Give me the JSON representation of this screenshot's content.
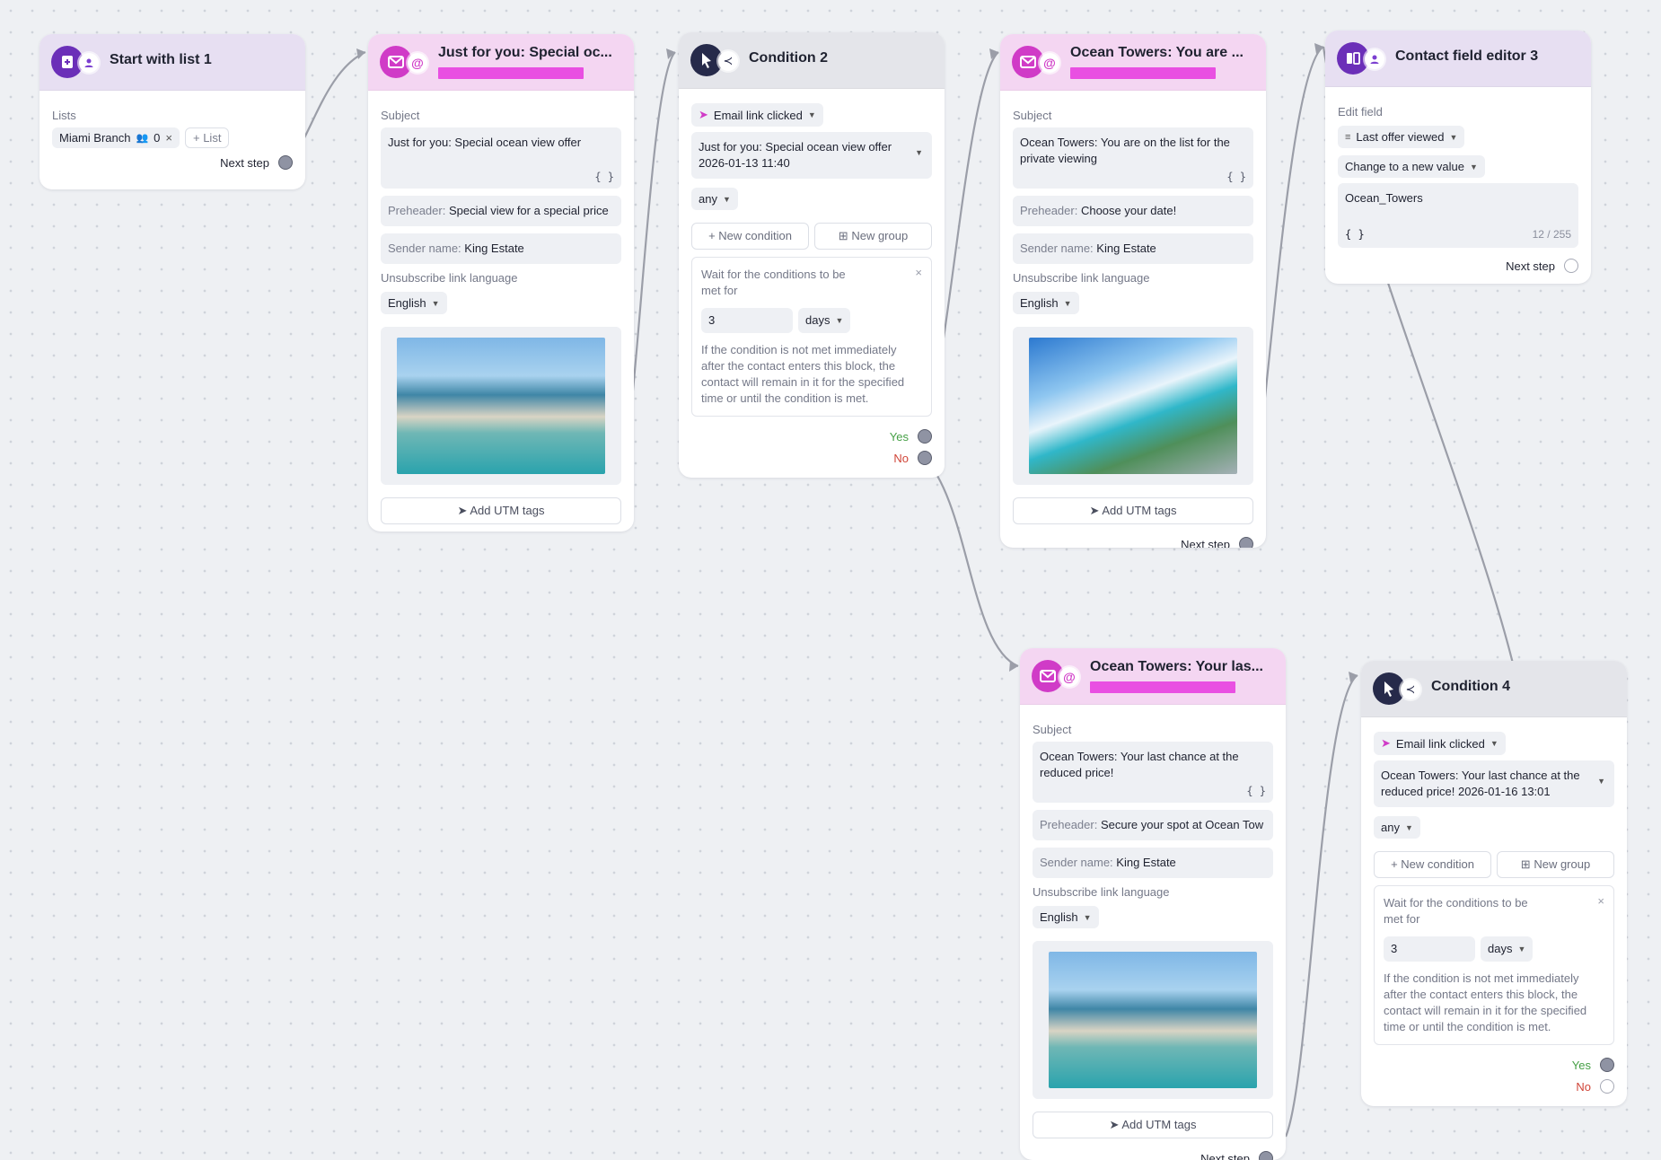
{
  "common": {
    "subject_label": "Subject",
    "preheader_label": "Preheader:",
    "sender_label": "Sender name:",
    "unsub_label": "Unsubscribe link language",
    "next_step": "Next step",
    "add_utm": "Add UTM tags",
    "braces": "{ }",
    "new_condition": "+ New condition",
    "new_group": "New group",
    "wait_title": "Wait for the conditions to be met for",
    "wait_unit": "days",
    "wait_note": "If the condition is not met immediately after the contact enters this block, the contact will remain in it for the specified time or until the condition is met.",
    "yes": "Yes",
    "no": "No",
    "any": "any",
    "email_link_clicked": "Email link clicked"
  },
  "start": {
    "title": "Start with list 1",
    "lists_label": "Lists",
    "list_name": "Miami Branch",
    "list_count": "0",
    "add_list": "+ List"
  },
  "email1": {
    "title": "Just for you: Special oc...",
    "subject": "Just for you: Special ocean view offer",
    "preheader": "Special view for a special price",
    "sender": "King Estate",
    "language": "English"
  },
  "cond2": {
    "title": "Condition 2",
    "email_ref": "Just for you: Special ocean view offer 2026-01-13 11:40",
    "wait_value": "3"
  },
  "email2": {
    "title": "Ocean Towers: You are ...",
    "subject": "Ocean Towers: You are on the list for the private viewing",
    "preheader": "Choose your date!",
    "sender": "King Estate",
    "language": "English"
  },
  "editor3": {
    "title": "Contact field editor 3",
    "edit_label": "Edit field",
    "field_name": "Last offer viewed",
    "action": "Change to a new value",
    "value": "Ocean_Towers",
    "counter": "12 / 255"
  },
  "email3": {
    "title": "Ocean Towers: Your las...",
    "subject": "Ocean Towers: Your last chance at the reduced price!",
    "preheader": "Secure your spot at Ocean Tow",
    "sender": "King Estate",
    "language": "English"
  },
  "cond4": {
    "title": "Condition 4",
    "email_ref": "Ocean Towers: Your last chance at the reduced price! 2026-01-16 13:01",
    "wait_value": "3"
  },
  "icons": [
    "list-start-icon",
    "user-icon",
    "envelope-icon",
    "at-icon",
    "cursor-icon",
    "share-icon",
    "contact-card-icon",
    "group-icon",
    "close-icon",
    "plus-icon",
    "rocket-icon",
    "chevron-down-icon"
  ],
  "colors": {
    "brand_purple": "#6b2fb8",
    "magenta": "#d03bc7",
    "navy": "#262a4a",
    "yes": "#46a046",
    "no": "#d04538"
  }
}
